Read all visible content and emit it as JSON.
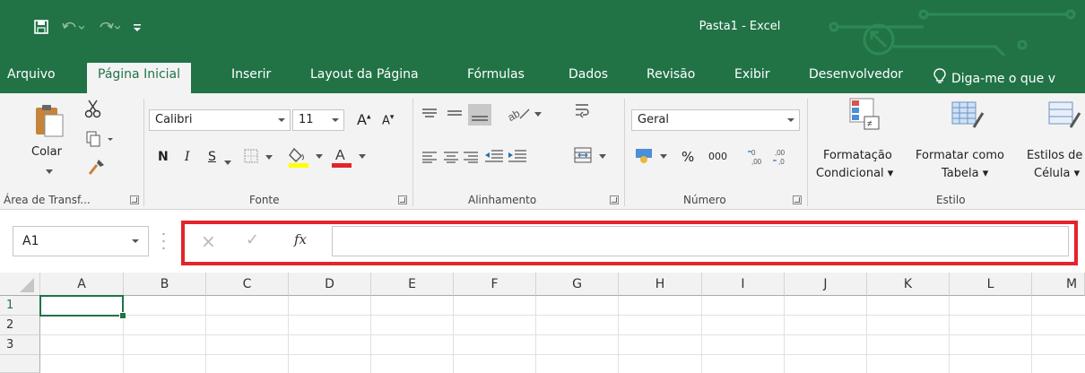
{
  "window": {
    "title": "Pasta1  -  Excel"
  },
  "tabs": [
    {
      "label": "Arquivo"
    },
    {
      "label": "Página Inicial",
      "active": true
    },
    {
      "label": "Inserir"
    },
    {
      "label": "Layout da Página"
    },
    {
      "label": "Fórmulas"
    },
    {
      "label": "Dados"
    },
    {
      "label": "Revisão"
    },
    {
      "label": "Exibir"
    },
    {
      "label": "Desenvolvedor"
    },
    {
      "label": "Diga-me o que v"
    }
  ],
  "ribbon": {
    "clipboard": {
      "paste_label": "Colar",
      "group_label": "Área de Transf..."
    },
    "font": {
      "font_name": "Calibri",
      "font_size": "11",
      "bold": "N",
      "italic": "I",
      "underline": "S",
      "group_label": "Fonte"
    },
    "alignment": {
      "group_label": "Alinhamento"
    },
    "number": {
      "format": "Geral",
      "percent": "%",
      "thousands": "000",
      "group_label": "Número"
    },
    "styles": {
      "conditional_line1": "Formatação",
      "conditional_line2": "Condicional",
      "table_line1": "Formatar como",
      "table_line2": "Tabela",
      "cell_line1": "Estilos de",
      "cell_line2": "Célula",
      "group_label": "Estilo"
    }
  },
  "formula_bar": {
    "name_box": "A1",
    "cancel_icon": "×",
    "enter_icon": "✓",
    "fx_label": "fx",
    "formula": ""
  },
  "sheet": {
    "columns": [
      "A",
      "B",
      "C",
      "D",
      "E",
      "F",
      "G",
      "H",
      "I",
      "J",
      "K",
      "L",
      "M"
    ],
    "rows": [
      "1",
      "2",
      "3"
    ],
    "active_cell": "A1"
  },
  "colors": {
    "excel_green": "#217346",
    "highlight_red": "#e3242b",
    "font_color_red": "#e3242b",
    "fill_yellow": "#ffff00"
  }
}
